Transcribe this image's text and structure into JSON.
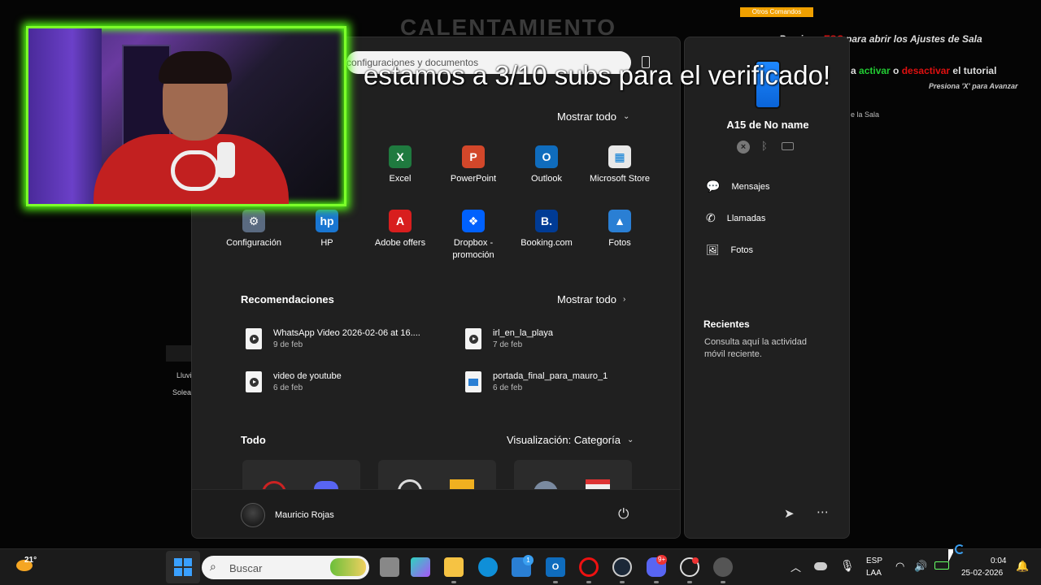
{
  "background": {
    "title": "CALENTAMIENTO",
    "badge": "Otros Comandos",
    "line1_a": "Presiona ",
    "line1_key": "ESC",
    "line1_b": " para abrir los Ajustes de Sala",
    "line2_a": "a ",
    "line2_on": "activar",
    "line2_mid": " o ",
    "line2_off": "desactivar",
    "line2_b": " el tutorial",
    "line3": "Presiona 'X' para Avanzar",
    "line4": "e la Sala",
    "weather_1": "Lluvi",
    "weather_2": "Solea"
  },
  "overlay": {
    "caption": "estamos a 3/10 subs para el verificado!"
  },
  "start_menu": {
    "search_placeholder": "configuraciones y documentos",
    "pinned_show_all": "Mostrar todo",
    "pinned": [
      {
        "label": "Excel",
        "color": "#1f7a3f",
        "glyph": "X"
      },
      {
        "label": "PowerPoint",
        "color": "#d2472a",
        "glyph": "P"
      },
      {
        "label": "Outlook",
        "color": "#0f6cbd",
        "glyph": "O"
      },
      {
        "label": "Microsoft Store",
        "color": "#e8e8e8",
        "glyph": "▦"
      },
      {
        "label": "Configuración",
        "color": "#5a6a80",
        "glyph": "⚙"
      },
      {
        "label": "HP",
        "color": "#1976d2",
        "glyph": "hp"
      },
      {
        "label": "Adobe offers",
        "color": "#d81e1e",
        "glyph": "A"
      },
      {
        "label": "Dropbox - promoción",
        "color": "#0061fe",
        "glyph": "❖"
      },
      {
        "label": "Booking.com",
        "color": "#003b95",
        "glyph": "B."
      },
      {
        "label": "Fotos",
        "color": "#2a7fd4",
        "glyph": "▲"
      }
    ],
    "recommendations_title": "Recomendaciones",
    "recommendations_show_all": "Mostrar todo",
    "recommendations": [
      {
        "name": "WhatsApp Video 2026-02-06 at 16....",
        "date": "9 de feb",
        "kind": "video"
      },
      {
        "name": "irl_en_la_playa",
        "date": "7 de feb",
        "kind": "video"
      },
      {
        "name": "video de youtube",
        "date": "6 de feb",
        "kind": "video"
      },
      {
        "name": "portada_final_para_mauro_1",
        "date": "6 de feb",
        "kind": "image"
      }
    ],
    "all_title": "Todo",
    "view_label": "Visualización: Categoría",
    "user_name": "Mauricio Rojas"
  },
  "phone_panel": {
    "device_name": "A15 de No name",
    "items": [
      "Mensajes",
      "Llamadas",
      "Fotos"
    ],
    "recent_title": "Recientes",
    "recent_text": "Consulta aquí la actividad móvil reciente."
  },
  "taskbar": {
    "temperature": "21°",
    "search_placeholder": "Buscar",
    "lang_1": "ESP",
    "lang_2": "LAA",
    "time": "0:04",
    "date": "25-02-2026",
    "discord_badge": "9+",
    "store_badge": "1"
  }
}
